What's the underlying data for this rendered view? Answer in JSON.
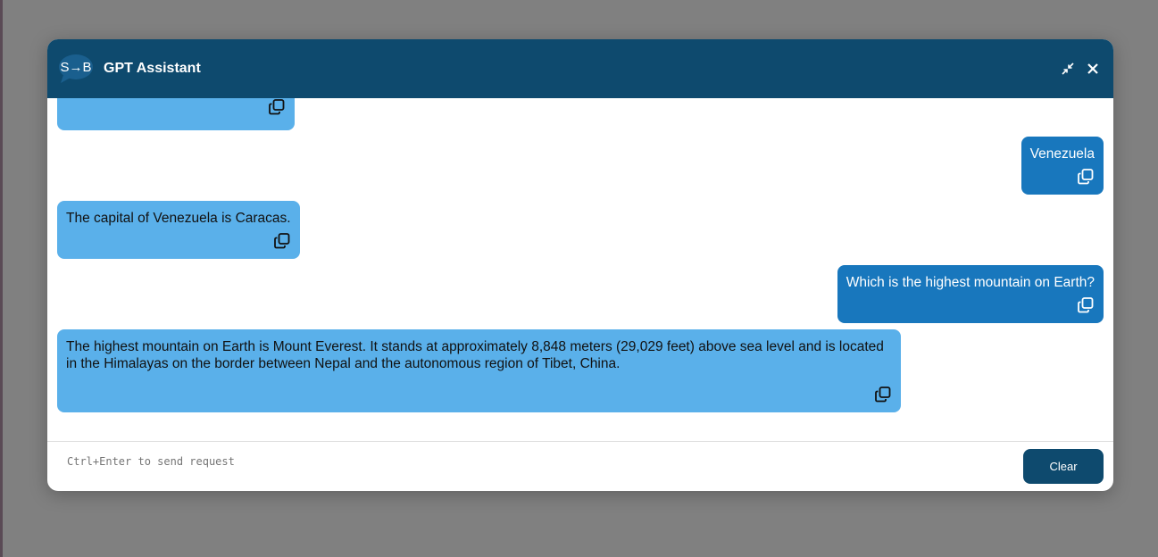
{
  "header": {
    "title": "GPT Assistant",
    "logo_text": "S→B"
  },
  "messages": [
    {
      "role": "assistant",
      "text": ""
    },
    {
      "role": "user",
      "text": "Venezuela"
    },
    {
      "role": "assistant",
      "text": "The capital of Venezuela is Caracas."
    },
    {
      "role": "user",
      "text": "Which is the highest mountain on Earth?"
    },
    {
      "role": "assistant",
      "text": "The highest mountain on Earth is Mount Everest. It stands at approximately 8,848 meters (29,029 feet) above sea level and is located in the Himalayas on the border between Nepal and the autonomous region of Tibet, China."
    }
  ],
  "footer": {
    "placeholder": "Ctrl+Enter to send request",
    "value": "",
    "clear_label": "Clear"
  },
  "colors": {
    "header": "#0e4a6e",
    "assistant_bubble": "#5ab0ea",
    "user_bubble": "#1877bd"
  }
}
